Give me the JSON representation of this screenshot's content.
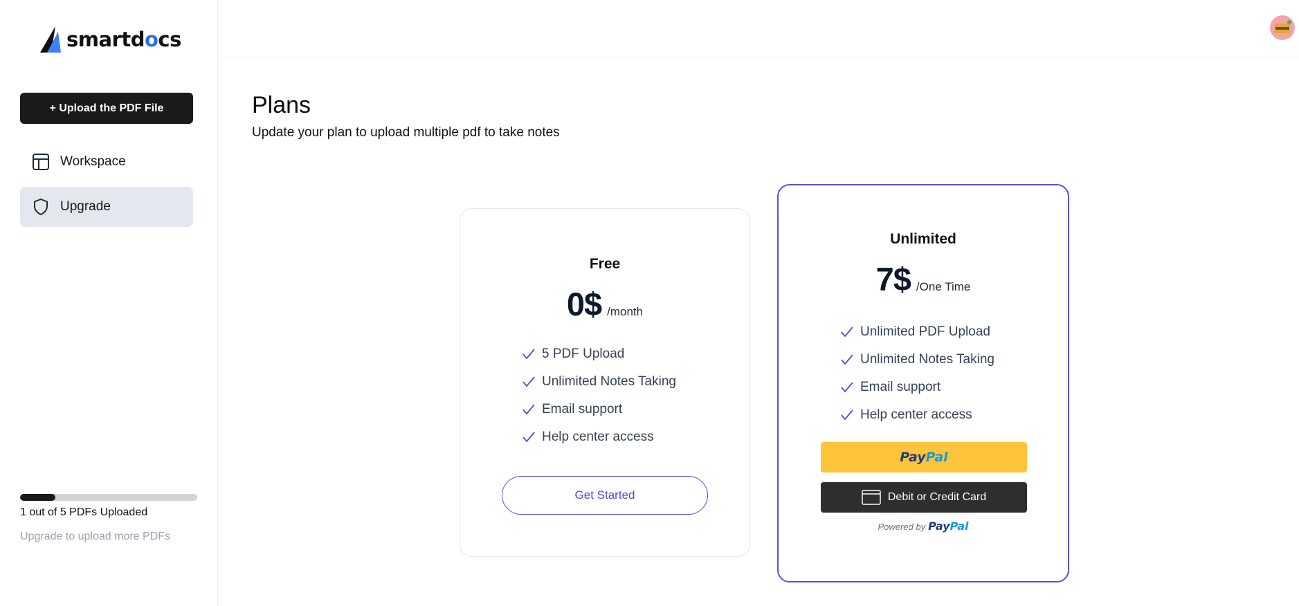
{
  "app": {
    "logo_text_a": "smartd",
    "logo_text_b": "o",
    "logo_text_c": "cs"
  },
  "sidebar": {
    "upload_label": "+ Upload the PDF File",
    "items": [
      {
        "label": "Workspace",
        "icon": "layout-icon"
      },
      {
        "label": "Upgrade",
        "icon": "shield-icon",
        "active": true
      }
    ],
    "progress": {
      "fraction": 0.2,
      "text": "1 out of 5 PDFs Uploaded",
      "hint": "Upgrade to upload more PDFs"
    }
  },
  "header": {
    "avatar_icon": "user-avatar"
  },
  "main": {
    "title": "Plans",
    "subtitle": "Update your plan to upload multiple pdf to take notes"
  },
  "plans": {
    "free": {
      "name": "Free",
      "price": "0$",
      "period": "/month",
      "features": [
        "5 PDF Upload",
        "Unlimited Notes Taking",
        "Email support",
        "Help center access"
      ],
      "cta": "Get Started"
    },
    "unlimited": {
      "name": "Unlimited",
      "price": "7$",
      "period": "/One Time",
      "features": [
        "Unlimited PDF Upload",
        "Unlimited Notes Taking",
        "Email support",
        "Help center access"
      ],
      "paypal_a": "Pay",
      "paypal_b": "Pal",
      "card_label": "Debit or Credit Card",
      "powered_by": "Powered by"
    }
  },
  "colors": {
    "accent": "#5b4ce0",
    "paypal_yellow": "#ffc439",
    "dark_button": "#1a1a1a"
  }
}
